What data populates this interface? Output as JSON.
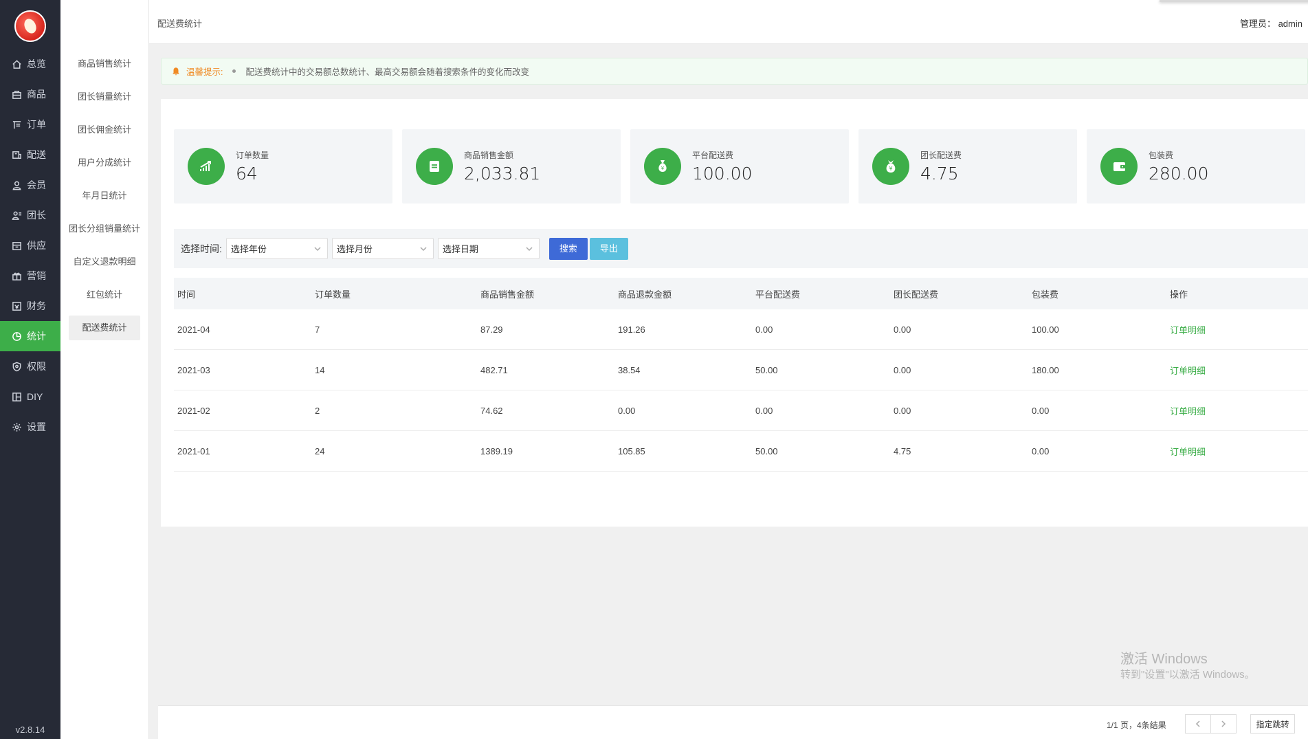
{
  "app": {
    "version": "v2.8.14"
  },
  "nav": {
    "items": [
      {
        "label": "总览",
        "icon": "home-icon"
      },
      {
        "label": "商品",
        "icon": "box-icon"
      },
      {
        "label": "订单",
        "icon": "order-icon"
      },
      {
        "label": "配送",
        "icon": "delivery-icon"
      },
      {
        "label": "会员",
        "icon": "user-icon"
      },
      {
        "label": "团长",
        "icon": "leader-icon"
      },
      {
        "label": "供应",
        "icon": "supply-icon"
      },
      {
        "label": "营销",
        "icon": "gift-icon"
      },
      {
        "label": "财务",
        "icon": "finance-icon"
      },
      {
        "label": "统计",
        "icon": "stats-icon"
      },
      {
        "label": "权限",
        "icon": "shield-icon"
      },
      {
        "label": "DIY",
        "icon": "layout-icon"
      },
      {
        "label": "设置",
        "icon": "gear-icon"
      }
    ],
    "active": "统计"
  },
  "submenu": {
    "items": [
      "商品销售统计",
      "团长销量统计",
      "团长佣金统计",
      "用户分成统计",
      "年月日统计",
      "团长分组销量统计",
      "自定义退款明细",
      "红包统计",
      "配送费统计"
    ],
    "active": "配送费统计"
  },
  "header": {
    "breadcrumb": "配送费统计",
    "admin": "管理员： admin"
  },
  "tip": {
    "label": "温馨提示:",
    "message": "配送费统计中的交易额总数统计、最高交易额会随着搜索条件的变化而改变"
  },
  "cards": [
    {
      "label": "订单数量",
      "value": "64",
      "icon": "chart-up-icon"
    },
    {
      "label": "商品销售金额",
      "value": "2,033.81",
      "icon": "document-icon"
    },
    {
      "label": "平台配送费",
      "value": "100.00",
      "icon": "money-bag-icon"
    },
    {
      "label": "团长配送费",
      "value": "4.75",
      "icon": "money-bag-yuan-icon"
    },
    {
      "label": "包装费",
      "value": "280.00",
      "icon": "wallet-icon"
    }
  ],
  "filter": {
    "label": "选择时间:",
    "year_placeholder": "选择年份",
    "month_placeholder": "选择月份",
    "date_placeholder": "选择日期",
    "search_label": "搜索",
    "export_label": "导出"
  },
  "table": {
    "headers": [
      "时间",
      "订单数量",
      "商品销售金额",
      "商品退款金额",
      "平台配送费",
      "团长配送费",
      "包装费",
      "操作"
    ],
    "rows": [
      [
        "2021-04",
        "7",
        "87.29",
        "191.26",
        "0.00",
        "0.00",
        "100.00",
        "订单明细"
      ],
      [
        "2021-03",
        "14",
        "482.71",
        "38.54",
        "50.00",
        "0.00",
        "180.00",
        "订单明细"
      ],
      [
        "2021-02",
        "2",
        "74.62",
        "0.00",
        "0.00",
        "0.00",
        "0.00",
        "订单明细"
      ],
      [
        "2021-01",
        "24",
        "1389.19",
        "105.85",
        "50.00",
        "4.75",
        "0.00",
        "订单明细"
      ]
    ]
  },
  "watermark": {
    "line1": "激活 Windows",
    "line2": "转到\"设置\"以激活 Windows。"
  },
  "pagination": {
    "info": "1/1 页，4条结果",
    "jump_label": "指定跳转"
  },
  "colors": {
    "sidebar": "#262a36",
    "accent": "#3dae49",
    "search_button": "#3e6ad7",
    "export_button": "#5bc0de",
    "tip_label": "#f08a24"
  }
}
